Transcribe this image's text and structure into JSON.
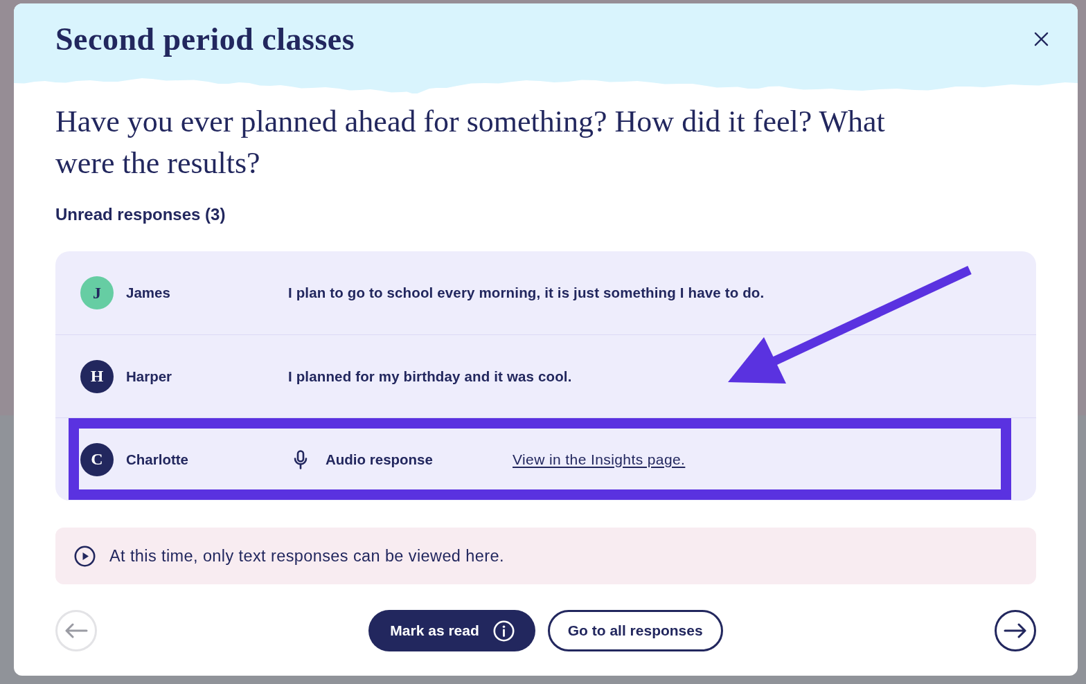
{
  "modal": {
    "title": "Second period classes"
  },
  "question": "Have you ever planned ahead for something? How did it feel? What were the results?",
  "unread_heading": "Unread responses (3)",
  "responses": [
    {
      "initial": "J",
      "name": "James",
      "color": "#66cda3",
      "kind": "text",
      "text": "I plan to go to school every morning, it is just something I have to do.",
      "highlighted": false
    },
    {
      "initial": "H",
      "name": "Harper",
      "color": "#22275e",
      "kind": "text",
      "text": "I planned for my birthday and it was cool.",
      "highlighted": false
    },
    {
      "initial": "C",
      "name": "Charlotte",
      "color": "#22275e",
      "kind": "audio",
      "label": "Audio response",
      "link": "View in the Insights page.",
      "highlighted": true
    }
  ],
  "notice": "At this time, only text responses can be viewed here.",
  "footer": {
    "previous": {
      "disabled": true
    },
    "mark_read": "Mark as read",
    "all_responses": "Go to all responses",
    "next": {
      "disabled": false
    }
  }
}
